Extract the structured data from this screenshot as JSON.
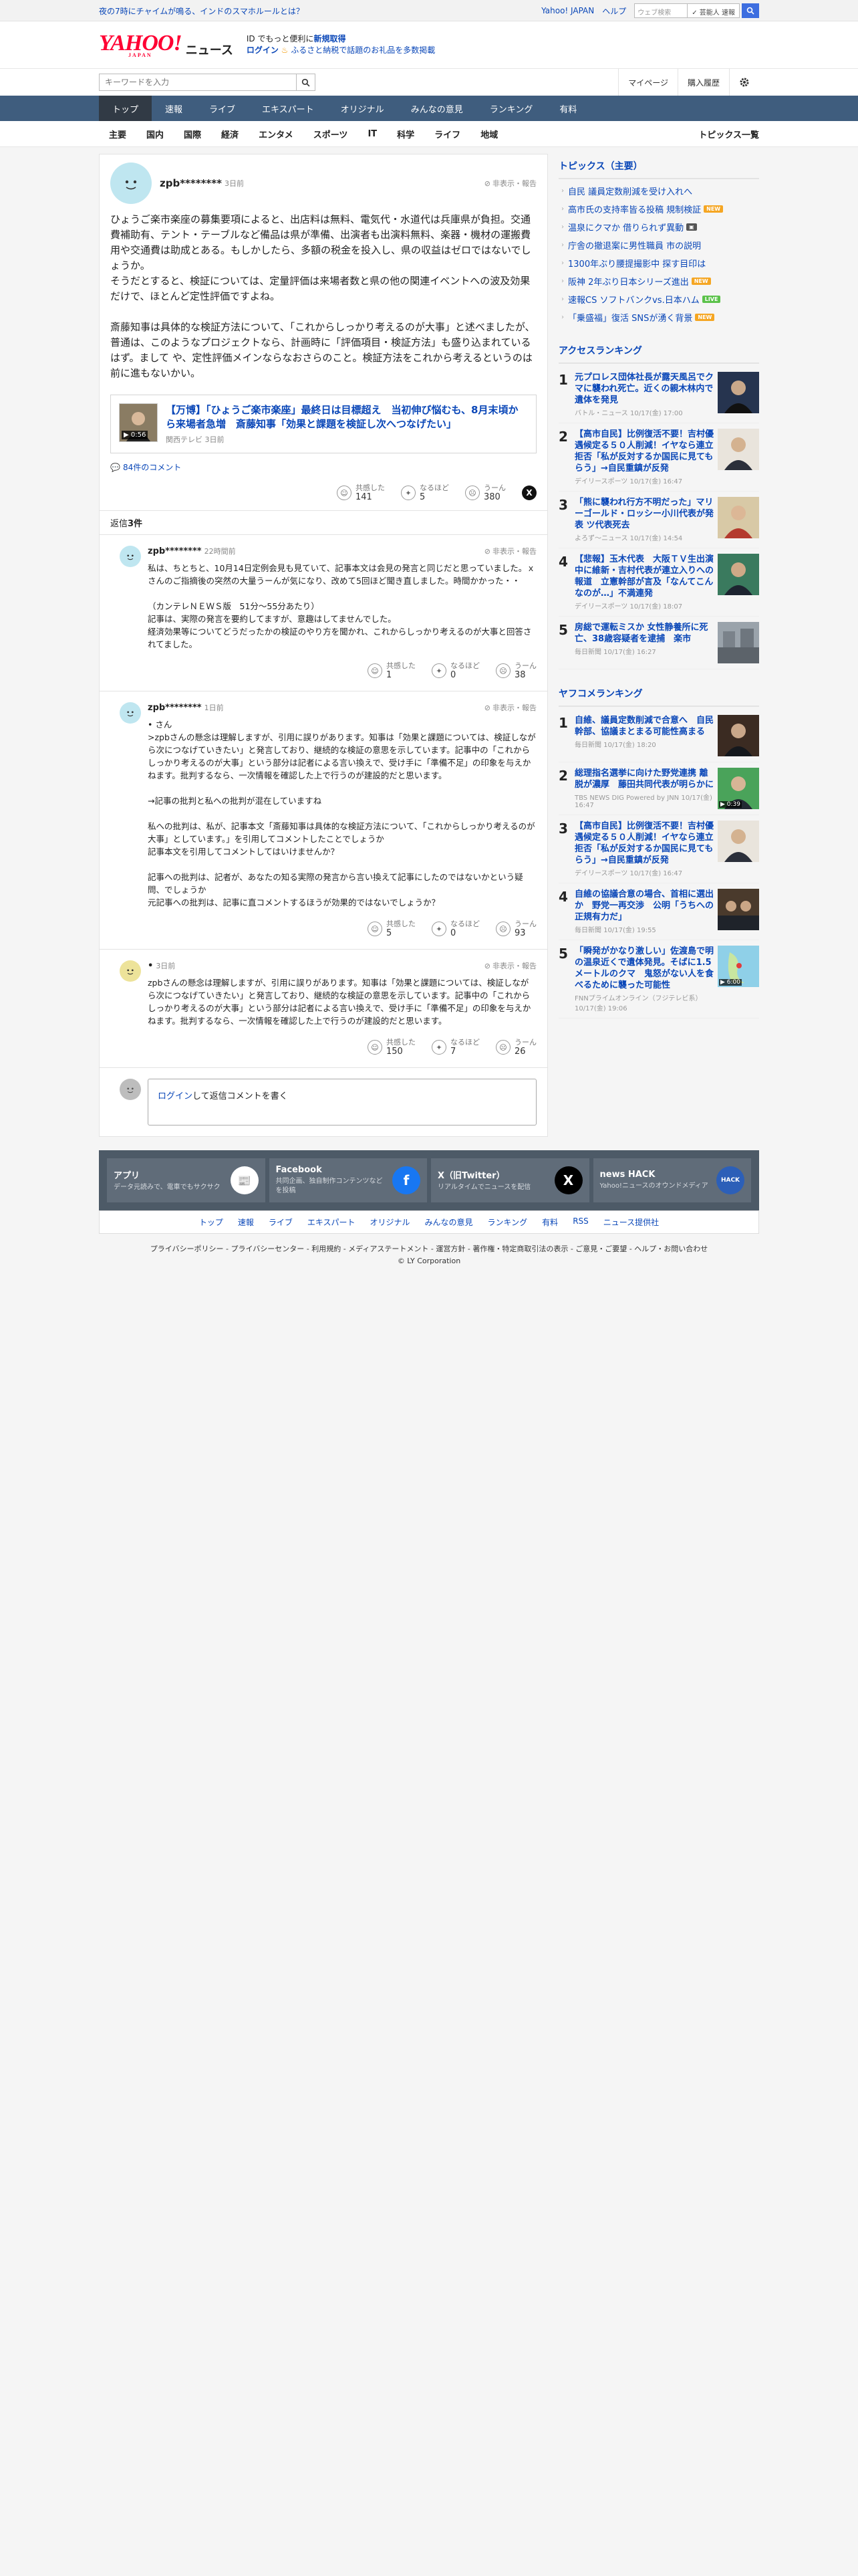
{
  "topbar": {
    "promo": "夜の7時にチャイムが鳴る、インドのスマホルールとは？",
    "links": [
      "Yahoo! JAPAN",
      "ヘルプ"
    ],
    "search_placeholder": "ウェブ検索",
    "filter_label": "✓ 芸能人 速報"
  },
  "header": {
    "logo_text": "YAHOO!",
    "logo_sub": "JAPAN",
    "news_label": "ニュース",
    "promo_line1_a": "ID でもっと便利に",
    "promo_line1_b": "新規取得",
    "promo_line2_a": "ログイン",
    "promo_line2_b": "ふるさと納税で話題のお礼品を多数掲載"
  },
  "toolbar": {
    "keyword_placeholder": "キーワードを入力",
    "mypage": "マイページ",
    "history": "購入履歴"
  },
  "nav_tabs": [
    {
      "label": "トップ"
    },
    {
      "label": "速報"
    },
    {
      "label": "ライブ"
    },
    {
      "label": "エキスパート"
    },
    {
      "label": "オリジナル"
    },
    {
      "label": "みんなの意見"
    },
    {
      "label": "ランキング"
    },
    {
      "label": "有料"
    }
  ],
  "sub_tabs": [
    {
      "label": "主要"
    },
    {
      "label": "国内"
    },
    {
      "label": "国際"
    },
    {
      "label": "経済"
    },
    {
      "label": "エンタメ"
    },
    {
      "label": "スポーツ"
    },
    {
      "label": "IT"
    },
    {
      "label": "科学"
    },
    {
      "label": "ライフ"
    },
    {
      "label": "地域"
    }
  ],
  "sub_right": "トピックス一覧",
  "comment": {
    "user": "zpb********",
    "time": "3日前",
    "report": "非表示・報告",
    "text": "ひょうご楽市楽座の募集要項によると、出店料は無料、電気代・水道代は兵庫県が負担。交通費補助有、テント・テーブルなど備品は県が準備、出演者も出演料無料、楽器・機材の運搬費用や交通費は助成とある。もしかしたら、多額の税金を投入し、県の収益はゼロではないでしょうか。\nそうだとすると、検証については、定量評価は来場者数と県の他の関連イベントへの波及効果だけで、ほとんど定性評価ですよね。\n\n斎藤知事は具体的な検証方法について、「これからしっかり考えるのが大事」と述べましたが、普通は、このようなプロジェクトなら、計画時に「評価項目・検証方法」も盛り込まれているはず。まして や、定性評価メインならなおさらのこと。検証方法をこれから考えるというのは前に進もないかい。",
    "article_title": "【万博】「ひょうご楽市楽座」最終日は目標超え　当初伸び悩むも、8月末頃から来場者急増　斎藤知事「効果と課題を検証し次へつなげたい」",
    "article_meta": "関西テレビ 3日前",
    "thumb_dur": "▶ 0:56",
    "comment_count": "84件のコメント",
    "reactions": [
      {
        "label": "共感した",
        "count": "141"
      },
      {
        "label": "なるほど",
        "count": "5"
      },
      {
        "label": "うーん",
        "count": "380"
      }
    ]
  },
  "reply_header": {
    "label": "返信",
    "count": "3件"
  },
  "replies": [
    {
      "user": "zpb********",
      "time": "22時間前",
      "report": "非表示・報告",
      "text": "私は、ちとちと、10月14日定例会見も見ていて、記事本文は会見の発言と同じだと思っていました。ｘさんのご指摘後の突然の大量うーんが気になり、改めて5回ほど聞き直しました。時間かかった・・\n\n（カンテレＮＥＷＳ版　51分〜55分あたり）\n記事は、実際の発言を要約してますが、意趣はしてませんでした。\n経済効果等についてどうだったかの検証のやり方を聞かれ、これからしっかり考えるのが大事と回答されてました。",
      "reactions": [
        {
          "label": "共感した",
          "count": "1"
        },
        {
          "label": "なるほど",
          "count": "0"
        },
        {
          "label": "うーん",
          "count": "38"
        }
      ]
    },
    {
      "user": "zpb********",
      "time": "1日前",
      "report": "非表示・報告",
      "text": "• さん\n>zpbさんの懸念は理解しますが、引用に誤りがあります。知事は「効果と課題については、検証しながら次につなげていきたい」と発言しており、継続的な検証の意思を示しています。記事中の「これからしっかり考えるのが大事」という部分は記者による言い換えで、受け手に「準備不足」の印象を与えかねます。批判するなら、一次情報を確認した上で行うのが建設的だと思います。\n\n→記事の批判と私への批判が混在していますね\n\n私への批判は、私が、記事本文「斎藤知事は具体的な検証方法について、「これからしっかり考えるのが大事」としています。」を引用してコメントしたことでしょうか\n記事本文を引用してコメントしてはいけませんか？\n\n記事への批判は、記者が、あなたの知る実際の発言から言い換えて記事にしたのではないかという疑問、でしょうか\n元記事への批判は、記事に直コメントするほうが効果的ではないでしょうか？",
      "reactions": [
        {
          "label": "共感した",
          "count": "5"
        },
        {
          "label": "なるほど",
          "count": "0"
        },
        {
          "label": "うーん",
          "count": "93"
        }
      ]
    },
    {
      "user": "•",
      "time": "3日前",
      "report": "非表示・報告",
      "text": "zpbさんの懸念は理解しますが、引用に誤りがあります。知事は「効果と課題については、検証しながら次につなげていきたい」と発言しており、継続的な検証の意思を示しています。記事中の「これからしっかり考えるのが大事」という部分は記者による言い換えで、受け手に「準備不足」の印象を与えかねます。批判するなら、一次情報を確認した上で行うのが建設的だと思います。",
      "reactions": [
        {
          "label": "共感した",
          "count": "150"
        },
        {
          "label": "なるほど",
          "count": "7"
        },
        {
          "label": "うーん",
          "count": "26"
        }
      ]
    }
  ],
  "reply_form": {
    "login": "ログイン",
    "rest": "して返信コメントを書く"
  },
  "topics": {
    "title": "トピックス（主要）",
    "items": [
      {
        "text": "自民 議員定数削減を受け入れへ",
        "badge": ""
      },
      {
        "text": "高市氏の支持率皆る投稿 規制検証",
        "badge": "NEW"
      },
      {
        "text": "温泉にクマか 借りられず異動",
        "badge": "IMG"
      },
      {
        "text": "庁舎の撤退案に男性職員 市の説明",
        "badge": ""
      },
      {
        "text": "1300年ぶり腰提撮影中 探す目印は",
        "badge": ""
      },
      {
        "text": "阪神 2年ぶり日本シリーズ進出",
        "badge": "NEW"
      },
      {
        "text": "速報CS ソフトバンクvs.日本ハム",
        "badge": "LIVE"
      },
      {
        "text": "「乗盛福」復活 SNSが湧く背景",
        "badge": "NEW"
      }
    ]
  },
  "access_ranking": {
    "title": "アクセスランキング",
    "items": [
      {
        "rank": "1",
        "title": "元プロレス団体社長が露天風呂でクマに襲われ死亡。近くの親木林内で遺体を発見",
        "meta": "バトル・ニュース 10/17(金) 17:00"
      },
      {
        "rank": "2",
        "title": "【高市自民】比例復活不要！吉村優遇候定る５０人削減！イヤなら連立拒否「私が反対するか国民に見てもらう」→自民重鎮が反発",
        "meta": "デイリースポーツ 10/17(金) 16:47"
      },
      {
        "rank": "3",
        "title": "「熊に襲われ行方不明だった」マリーゴールド・ロッシー小川代表が発表 ツ代表死去",
        "meta": "よろず〜ニュース 10/17(金) 14:54"
      },
      {
        "rank": "4",
        "title": "【悲報】玉木代表　大阪ＴＶ生出演中に維新・吉村代表が連立入りへの報道　立憲幹部が言及「なんてこんなのが…」不満連発",
        "meta": "デイリースポーツ 10/17(金) 18:07"
      },
      {
        "rank": "5",
        "title": "房総で運転ミスか 女性静養所に死亡、38歳容疑者を逮捕　楽市",
        "meta": "毎日新聞 10/17(金) 16:27"
      }
    ]
  },
  "yahoo_ranking": {
    "title": "ヤフコメランキング",
    "items": [
      {
        "rank": "1",
        "title": "自維、議員定数削減で合意へ　自民幹部、協議まとまる可能性高まる",
        "meta": "毎日新聞 10/17(金) 18:20",
        "dur": ""
      },
      {
        "rank": "2",
        "title": "総理指名選挙に向けた野党連携 離脱が濃厚　藤田共同代表が明らかに",
        "meta": "TBS NEWS DIG Powered by JNN 10/17(金) 16:47",
        "dur": "▶ 0:39"
      },
      {
        "rank": "3",
        "title": "【高市自民】比例復活不要！吉村優遇候定る５０人削減！イヤなら連立拒否「私が反対するか国民に見てもらう」→自民重鎮が反発",
        "meta": "デイリースポーツ 10/17(金) 16:47",
        "dur": ""
      },
      {
        "rank": "4",
        "title": "自維の協議合意の場合、首相に選出か　野党一再交渉　公明「うちへの正規有力だ」",
        "meta": "毎日新聞 10/17(金) 19:55",
        "dur": ""
      },
      {
        "rank": "5",
        "title": "「瞬発がかなり激しい」佐渡島で明の温泉近くで遺体発見。そばに1.5メートルのクマ　鬼怒がない人を食べるために襲った可能性",
        "meta": "FNNプライムオンライン（フジテレビ系） 10/17(金) 19:06",
        "dur": "▶ 6:00"
      }
    ]
  },
  "footer": {
    "cards": [
      {
        "title": "アプリ",
        "desc": "データ元読みで、電車でもサクサク"
      },
      {
        "title": "Facebook",
        "desc": "共同企画、独自制作コンテンツなどを投稿"
      },
      {
        "title": "X（旧Twitter）",
        "desc": "リアルタイムでニュースを配信"
      },
      {
        "title": "news HACK",
        "desc": "Yahoo!ニュースのオウンドメディア"
      }
    ],
    "nav": [
      "トップ",
      "速報",
      "ライブ",
      "エキスパート",
      "オリジナル",
      "みんなの意見",
      "ランキング",
      "有料",
      "RSS",
      "ニュース提供社"
    ],
    "links": "プライバシーポリシー - プライバシーセンター - 利用規約 - メディアステートメント - 運営方針 - 著作権・特定商取引法の表示 - ご意見・ご要望 - ヘルプ・お問い合わせ",
    "copyright": "© LY Corporation"
  }
}
